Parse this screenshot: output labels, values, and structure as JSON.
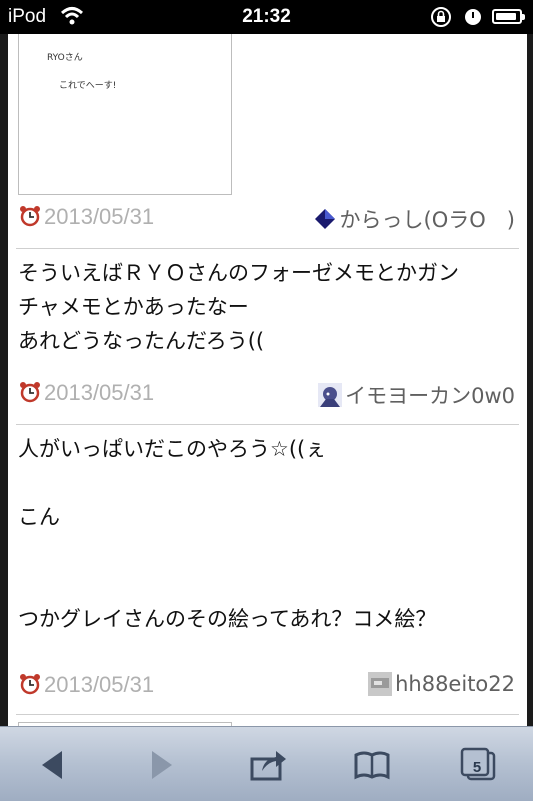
{
  "status_bar": {
    "carrier": "iPod",
    "time": "21:32"
  },
  "posts": [
    {
      "date": "2013/05/31",
      "user": "からっし(OラO　)",
      "avatar": "diamond-icon",
      "drawing_text": [
        "RYOさん",
        "これでへーす!"
      ]
    },
    {
      "date": "2013/05/31",
      "user": "イモヨーカン0w0",
      "avatar": "anime-avatar",
      "lines": [
        "そういえばＲＹＯさんのフォーゼメモとかガン",
        "チャメモとかあったなー",
        "あれどうなったんだろう(("
      ]
    },
    {
      "date": "2013/05/31",
      "user": "hh88eito22",
      "avatar": "photo-avatar",
      "lines": [
        "人がいっぱいだこのやろう☆((ぇ",
        "",
        "こん",
        "",
        "",
        "つかグレイさんのその絵ってあれ？コメ絵？"
      ]
    }
  ],
  "toolbar": {
    "tabs_count": "5"
  }
}
